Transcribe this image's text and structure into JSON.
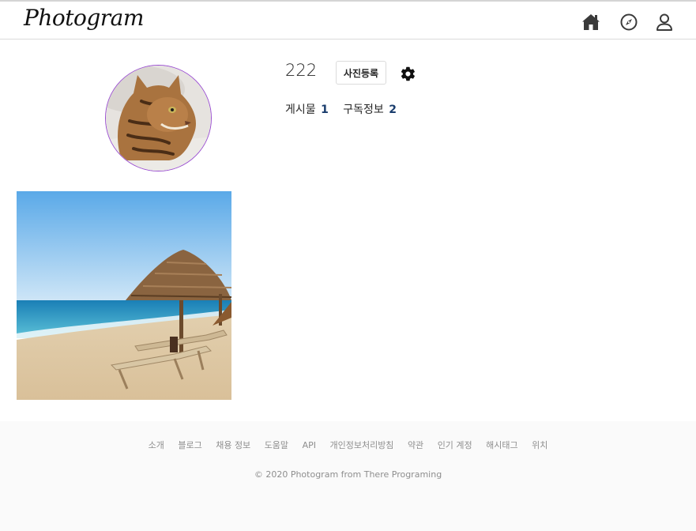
{
  "header": {
    "logo": "Photogram",
    "icons": [
      "home-icon",
      "compass-icon",
      "user-icon"
    ]
  },
  "profile": {
    "username": "222",
    "upload_button": "사진등록",
    "settings_icon": "gear-icon",
    "stats": {
      "posts_label": "게시물",
      "posts_count": "1",
      "subscribe_label": "구독정보",
      "subscribe_count": "2"
    }
  },
  "footer": {
    "links": [
      "소개",
      "블로그",
      "채용 정보",
      "도움말",
      "API",
      "개인정보처리방침",
      "약관",
      "인기 계정",
      "해시태그",
      "위치"
    ],
    "copyright": "© 2020 Photogram from There Programing"
  }
}
